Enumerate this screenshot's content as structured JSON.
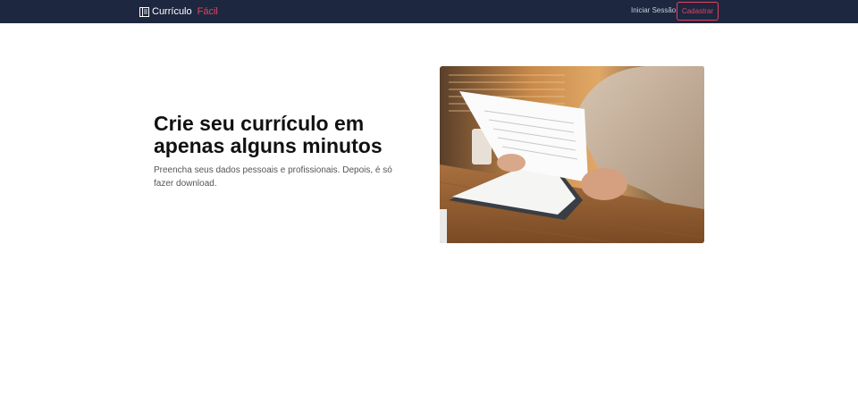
{
  "navbar": {
    "brand_text": "Currículo",
    "brand_accent": "Fácil",
    "brand_icon": "resume-icon",
    "login_label": "Iniciar Sessão",
    "signup_label": "Cadastrar"
  },
  "hero": {
    "title": "Crie seu currículo em apenas alguns minutos",
    "subtitle": "Preencha seus dados pessoais e profissionais. Depois, é só fazer download.",
    "image": "photo-person-reading-documents"
  },
  "colors": {
    "navbar_bg": "#1d2740",
    "accent": "#e8425c",
    "text": "#111111"
  }
}
